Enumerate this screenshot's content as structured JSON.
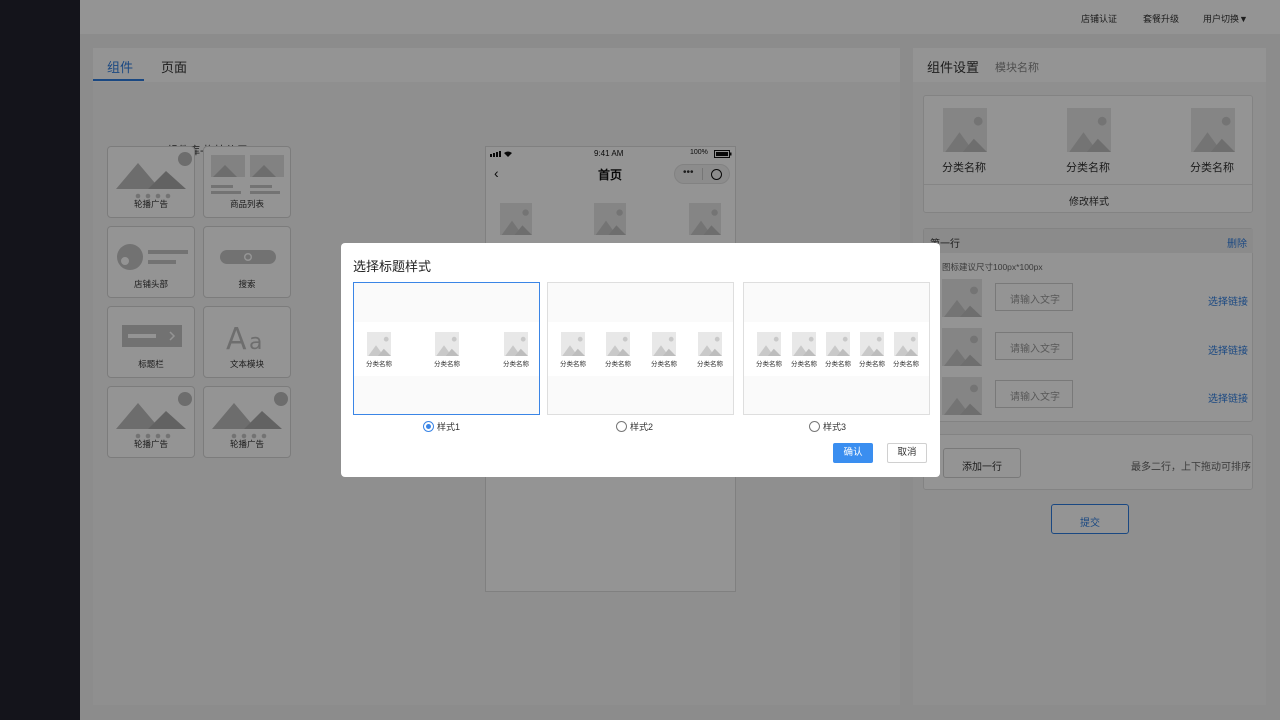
{
  "topbar": {
    "links": [
      "店铺认证",
      "套餐升级",
      "用户切换▼"
    ]
  },
  "left": {
    "tabs": [
      "组件",
      "页面"
    ],
    "library_title": "组件库-拖拽使用",
    "components": [
      "轮播广告",
      "商品列表",
      "店铺头部",
      "搜索",
      "标题栏",
      "文本模块",
      "轮播广告",
      "轮播广告"
    ]
  },
  "phone": {
    "time": "9:41 AM",
    "battery": "100%",
    "title": "首页"
  },
  "right": {
    "title": "组件设置",
    "subtitle": "模块名称",
    "category_label": "分类名称",
    "modify_style": "修改样式",
    "row_title": "第一行",
    "delete": "删除",
    "hint": "图标建议尺寸100px*100px",
    "input_placeholder": "请输入文字",
    "link_label": "选择链接",
    "add_row": "添加一行",
    "add_hint": "最多二行，上下拖动可排序",
    "submit": "提交"
  },
  "modal": {
    "title": "选择标题样式",
    "mini_label": "分类名称",
    "options": [
      {
        "label": "样式1",
        "selected": true,
        "count": 3
      },
      {
        "label": "样式2",
        "selected": false,
        "count": 4
      },
      {
        "label": "样式3",
        "selected": false,
        "count": 5
      }
    ],
    "confirm": "确认",
    "cancel": "取消"
  },
  "colors": {
    "accent": "#2e7de0",
    "sidebar": "#24242f",
    "overlay": "rgba(0,0,0,0.42)"
  }
}
